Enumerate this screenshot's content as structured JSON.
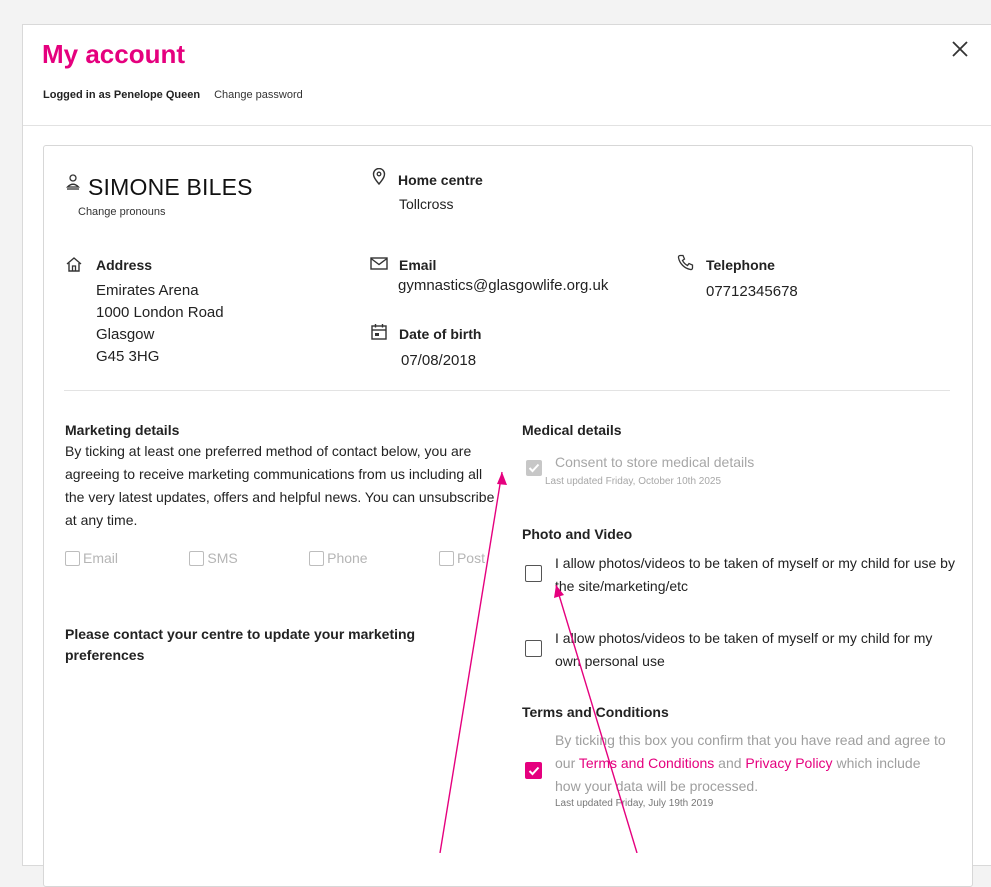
{
  "header": {
    "title": "My account",
    "logged_in_label": "Logged in as Penelope Queen",
    "change_password": "Change password"
  },
  "member": {
    "name": "SIMONE BILES",
    "change_pronouns": "Change pronouns",
    "home_centre_label": "Home centre",
    "home_centre_value": "Tollcross",
    "address_label": "Address",
    "address_lines": [
      "Emirates Arena",
      "1000 London Road",
      "Glasgow",
      "G45 3HG"
    ],
    "email_label": "Email",
    "email_value": "gymnastics@glasgowlife.org.uk",
    "dob_label": "Date of birth",
    "dob_value": "07/08/2018",
    "telephone_label": "Telephone",
    "telephone_value": "07712345678"
  },
  "marketing": {
    "title": "Marketing details",
    "description": "By ticking at least one preferred method of contact below, you are agreeing to receive marketing communications from us including all the very latest updates, offers and helpful news. You can unsubscribe at any time.",
    "options": [
      "Email",
      "SMS",
      "Phone",
      "Post"
    ],
    "contact_note": "Please contact your centre to update your marketing preferences"
  },
  "medical": {
    "title": "Medical details",
    "consent_label": "Consent to store medical details",
    "last_updated": "Last updated Friday, October 10th 2025",
    "checked": true
  },
  "photo": {
    "title": "Photo and Video",
    "option1": "I allow photos/videos to be taken of myself or my child for use by the site/marketing/etc",
    "option2": "I allow photos/videos to be taken of myself or my child for my own personal use"
  },
  "terms": {
    "title": "Terms and Conditions",
    "text_before": "By ticking this box you confirm that you have read and agree to our",
    "terms_link": "Terms and Conditions",
    "and_word": "and",
    "privacy_link": "Privacy Policy",
    "text_after": "which include how your data will be processed.",
    "last_updated": "Last updated Friday, July 19th 2019",
    "checked": true
  },
  "colors": {
    "brand": "#e5007e",
    "arrow": "#e5007e"
  }
}
